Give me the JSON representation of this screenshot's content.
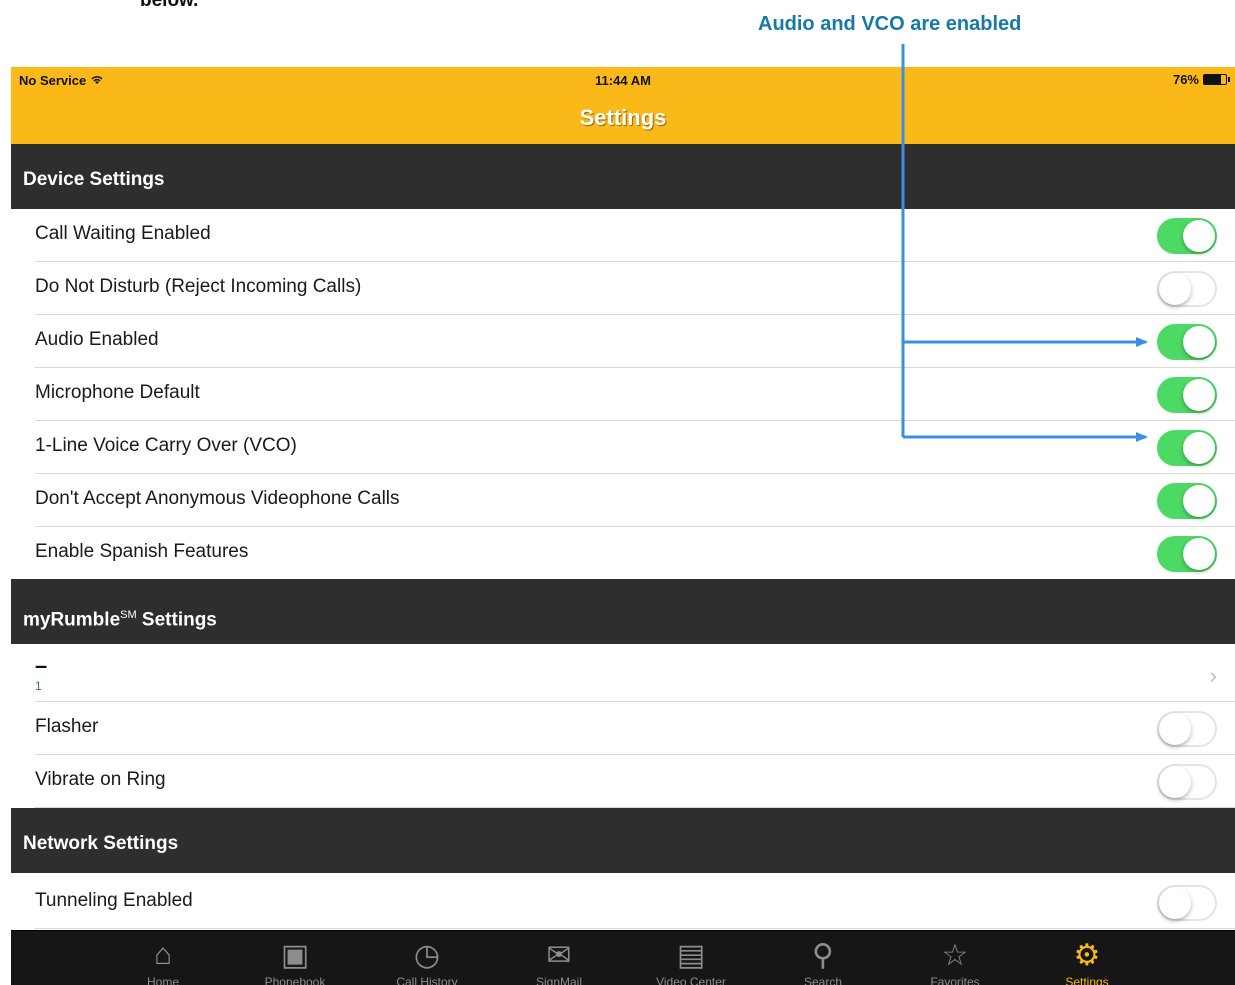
{
  "document": {
    "fragment_text": "below.",
    "callout": "Audio and VCO are enabled"
  },
  "status_bar": {
    "carrier": "No Service",
    "time": "11:44 AM",
    "battery": "76%",
    "battery_level": 0.76
  },
  "nav": {
    "title": "Settings"
  },
  "sections": {
    "device": {
      "header": "Device Settings",
      "rows": [
        {
          "label": "Call Waiting Enabled",
          "on": true
        },
        {
          "label": "Do Not Disturb (Reject Incoming Calls)",
          "on": false
        },
        {
          "label": "Audio Enabled",
          "on": true
        },
        {
          "label": "Microphone Default",
          "on": true
        },
        {
          "label": "1-Line Voice Carry Over (VCO)",
          "on": true
        },
        {
          "label": "Don't Accept Anonymous Videophone Calls",
          "on": true
        },
        {
          "label": "Enable Spanish Features",
          "on": true
        }
      ]
    },
    "myrumble": {
      "header_prefix": "myRumble",
      "header_sup": "SM",
      "header_suffix": " Settings",
      "ringtone_dash": "–",
      "ringtone_value": "1",
      "rows": [
        {
          "label": "Flasher",
          "on": false
        },
        {
          "label": "Vibrate on Ring",
          "on": false
        }
      ]
    },
    "network": {
      "header": "Network Settings",
      "rows": [
        {
          "label": "Tunneling Enabled",
          "on": false
        }
      ]
    }
  },
  "tabs": [
    {
      "label": "Home",
      "icon": "home-icon",
      "glyph": "⌂"
    },
    {
      "label": "Phonebook",
      "icon": "phonebook-icon",
      "glyph": "▣"
    },
    {
      "label": "Call History",
      "icon": "call-history-icon",
      "glyph": "◷"
    },
    {
      "label": "SignMail",
      "icon": "signmail-icon",
      "glyph": "✉"
    },
    {
      "label": "Video Center",
      "icon": "video-center-icon",
      "glyph": "▤"
    },
    {
      "label": "Search",
      "icon": "search-icon",
      "glyph": "⚲"
    },
    {
      "label": "Favorites",
      "icon": "favorites-icon",
      "glyph": "☆"
    },
    {
      "label": "Settings",
      "icon": "settings-gear-icon",
      "glyph": "⚙",
      "active": true
    }
  ],
  "colors": {
    "accent": "#fbb819",
    "toggle_on": "#4cd964",
    "section_header": "#2e2e2e",
    "callout": "#1779a8",
    "arrow": "#3b8ee0"
  }
}
